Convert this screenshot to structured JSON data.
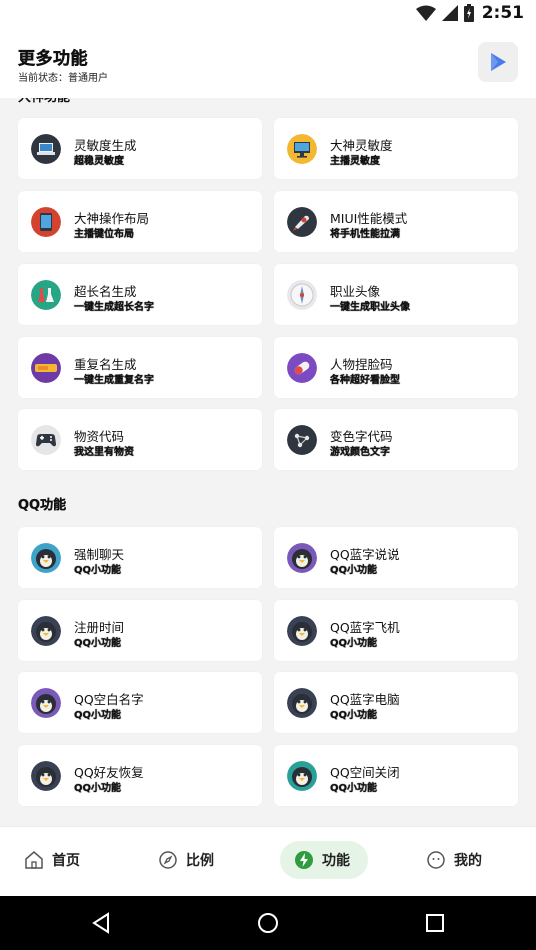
{
  "status": {
    "time": "2:51"
  },
  "header": {
    "title": "更多功能",
    "subtitle": "当前状态：普通用户"
  },
  "section_cut": {
    "title": "大神功能"
  },
  "grid1": [
    {
      "title": "灵敏度生成",
      "sub": "超稳灵敏度",
      "icon": "laptop-icon"
    },
    {
      "title": "大神灵敏度",
      "sub": "主播灵敏度",
      "icon": "monitor-icon"
    },
    {
      "title": "大神操作布局",
      "sub": "主播键位布局",
      "icon": "tablet-icon"
    },
    {
      "title": "MIUI性能模式",
      "sub": "将手机性能拉满",
      "icon": "rocket-icon"
    },
    {
      "title": "超长名生成",
      "sub": "一键生成超长名字",
      "icon": "potion-icon"
    },
    {
      "title": "职业头像",
      "sub": "一键生成职业头像",
      "icon": "compass-icon"
    },
    {
      "title": "重复名生成",
      "sub": "一键生成重复名字",
      "icon": "ticket-icon"
    },
    {
      "title": "人物捏脸码",
      "sub": "各种超好看脸型",
      "icon": "pill-icon"
    },
    {
      "title": "物资代码",
      "sub": "我这里有物资",
      "icon": "gamepad-icon"
    },
    {
      "title": "变色字代码",
      "sub": "游戏颜色文字",
      "icon": "network-icon"
    }
  ],
  "section_qq": {
    "title": "QQ功能"
  },
  "grid2": [
    {
      "title": "强制聊天",
      "sub": "QQ小功能",
      "ring": "#3ea3c9"
    },
    {
      "title": "QQ蓝字说说",
      "sub": "QQ小功能",
      "ring": "#7b59b8"
    },
    {
      "title": "注册时间",
      "sub": "QQ小功能",
      "ring": "#3a4154"
    },
    {
      "title": "QQ蓝字飞机",
      "sub": "QQ小功能",
      "ring": "#3a4154"
    },
    {
      "title": "QQ空白名字",
      "sub": "QQ小功能",
      "ring": "#7b59b8"
    },
    {
      "title": "QQ蓝字电脑",
      "sub": "QQ小功能",
      "ring": "#3a4154"
    },
    {
      "title": "QQ好友恢复",
      "sub": "QQ小功能",
      "ring": "#3a4154"
    },
    {
      "title": "QQ空间关闭",
      "sub": "QQ小功能",
      "ring": "#2aa198"
    }
  ],
  "nav": {
    "home": "首页",
    "ratio": "比例",
    "features": "功能",
    "mine": "我的"
  },
  "colors": {
    "accent": "#2e9d3f",
    "active_bg": "#e6f4e8"
  }
}
